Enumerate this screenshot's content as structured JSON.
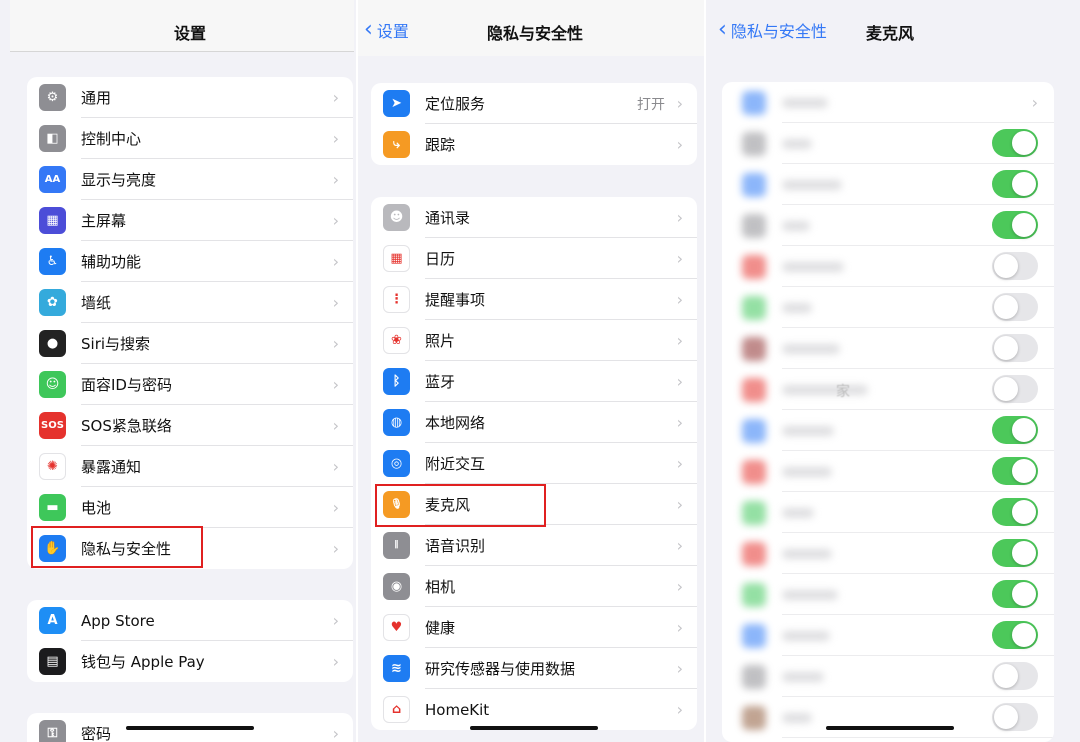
{
  "panel1": {
    "title": "设置",
    "group1": [
      {
        "label": "通用",
        "icon": "gear-icon",
        "color": "#8e8e93",
        "glyph": "⚙"
      },
      {
        "label": "控制中心",
        "icon": "toggle-icon",
        "color": "#8e8e93",
        "glyph": "◧"
      },
      {
        "label": "显示与亮度",
        "icon": "text-size-icon",
        "color": "#3478f6",
        "glyph": "AA"
      },
      {
        "label": "主屏幕",
        "icon": "home-grid-icon",
        "color": "#4c4dd8",
        "glyph": "▦"
      },
      {
        "label": "辅助功能",
        "icon": "accessibility-icon",
        "color": "#1e7cf2",
        "glyph": "♿"
      },
      {
        "label": "墙纸",
        "icon": "flower-icon",
        "color": "#34aadc",
        "glyph": "✿"
      },
      {
        "label": "Siri与搜索",
        "icon": "siri-icon",
        "color": "#222",
        "glyph": "●"
      },
      {
        "label": "面容ID与密码",
        "icon": "face-id-icon",
        "color": "#3ec75a",
        "glyph": "☺"
      },
      {
        "label": "SOS紧急联络",
        "icon": "sos-icon",
        "color": "#e5322d",
        "glyph": "SOS"
      },
      {
        "label": "暴露通知",
        "icon": "exposure-icon",
        "color": "#fff",
        "glyph": "✺"
      },
      {
        "label": "电池",
        "icon": "battery-icon",
        "color": "#3ec75a",
        "glyph": "▬"
      },
      {
        "label": "隐私与安全性",
        "icon": "hand-icon",
        "color": "#1e7cf2",
        "glyph": "✋"
      }
    ],
    "group2": [
      {
        "label": "App Store",
        "icon": "app-store-icon",
        "color": "#1e8ef5",
        "glyph": "A"
      },
      {
        "label": "钱包与 Apple Pay",
        "icon": "wallet-icon",
        "color": "#1c1c1e",
        "glyph": "▤"
      }
    ],
    "group3": [
      {
        "label": "密码",
        "icon": "key-icon",
        "color": "#8e8e93",
        "glyph": "⚿"
      }
    ]
  },
  "panel2": {
    "back_label": "设置",
    "title": "隐私与安全性",
    "group1": [
      {
        "label": "定位服务",
        "value": "打开",
        "icon": "location-arrow-icon",
        "color": "#1e7cf2",
        "glyph": "➤"
      },
      {
        "label": "跟踪",
        "icon": "tracking-icon",
        "color": "#f59a23",
        "glyph": "⤷"
      }
    ],
    "group2": [
      {
        "label": "通讯录",
        "icon": "contacts-icon",
        "color": "#b9b9bd",
        "glyph": "☻"
      },
      {
        "label": "日历",
        "icon": "calendar-icon",
        "color": "#ffffff",
        "glyph": "▦"
      },
      {
        "label": "提醒事项",
        "icon": "reminders-icon",
        "color": "#ffffff",
        "glyph": "⋮"
      },
      {
        "label": "照片",
        "icon": "photos-icon",
        "color": "#ffffff",
        "glyph": "❀"
      },
      {
        "label": "蓝牙",
        "icon": "bluetooth-icon",
        "color": "#1e7cf2",
        "glyph": "ᛒ"
      },
      {
        "label": "本地网络",
        "icon": "globe-icon",
        "color": "#1e7cf2",
        "glyph": "◍"
      },
      {
        "label": "附近交互",
        "icon": "nearby-icon",
        "color": "#1e7cf2",
        "glyph": "◎"
      },
      {
        "label": "麦克风",
        "icon": "microphone-icon",
        "color": "#f59a23",
        "glyph": "🎙"
      },
      {
        "label": "语音识别",
        "icon": "waveform-icon",
        "color": "#8e8e93",
        "glyph": "𝄃"
      },
      {
        "label": "相机",
        "icon": "camera-icon",
        "color": "#8e8e93",
        "glyph": "◉"
      },
      {
        "label": "健康",
        "icon": "heart-icon",
        "color": "#ffffff",
        "glyph": "♥"
      },
      {
        "label": "研究传感器与使用数据",
        "icon": "research-icon",
        "color": "#1e7cf2",
        "glyph": "≋"
      },
      {
        "label": "HomeKit",
        "icon": "home-icon",
        "color": "#ffffff",
        "glyph": "⌂"
      }
    ]
  },
  "panel3": {
    "back_label": "隐私与安全性",
    "title": "麦克风",
    "ghost_text": "家",
    "toggles": [
      true,
      true,
      true,
      false,
      false,
      false,
      false,
      true,
      true,
      true,
      true,
      true,
      true,
      false,
      false
    ],
    "icon_colors": [
      "#2f7bf6",
      "#8e8e93",
      "#2f7bf6",
      "#8e8e93",
      "#e5322d",
      "#3ec75a",
      "#8e2d2d",
      "#e5322d",
      "#2f7bf6",
      "#e5322d",
      "#3ec75a",
      "#e5322d",
      "#3ec75a",
      "#2f7bf6",
      "#8e8e93",
      "#8e5a3a"
    ]
  }
}
